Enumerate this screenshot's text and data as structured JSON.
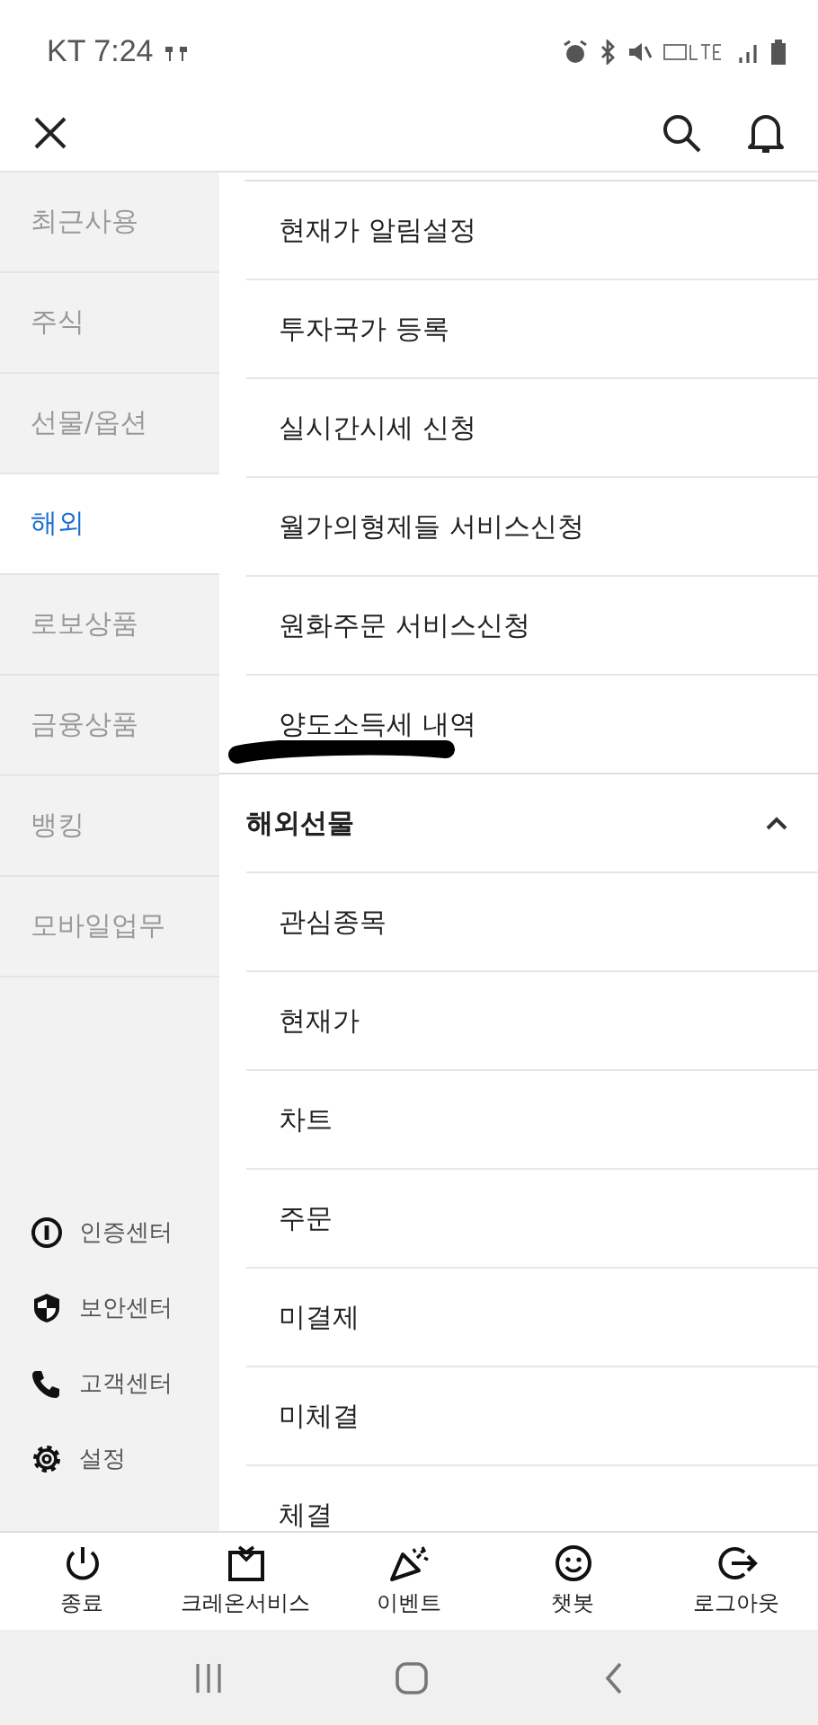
{
  "status_bar": {
    "carrier_time": "KT 7:24"
  },
  "sidebar": {
    "items": [
      {
        "label": "최근사용",
        "selected": false
      },
      {
        "label": "주식",
        "selected": false
      },
      {
        "label": "선물/옵션",
        "selected": false
      },
      {
        "label": "해외",
        "selected": true
      },
      {
        "label": "로보상품",
        "selected": false
      },
      {
        "label": "금융상품",
        "selected": false
      },
      {
        "label": "뱅킹",
        "selected": false
      },
      {
        "label": "모바일업무",
        "selected": false
      }
    ],
    "links": [
      {
        "kind": "cert",
        "label": "인증센터"
      },
      {
        "kind": "security",
        "label": "보안센터"
      },
      {
        "kind": "phone",
        "label": "고객센터"
      },
      {
        "kind": "settings",
        "label": "설정"
      }
    ]
  },
  "menu": {
    "items": [
      "현재가 알림설정",
      "투자국가 등록",
      "실시간시세 신청",
      "월가의형제들 서비스신청",
      "원화주문 서비스신청",
      "양도소득세 내역"
    ],
    "groups": [
      {
        "title": "해외선물",
        "expanded": true,
        "items": [
          "관심종목",
          "현재가",
          "차트",
          "주문",
          "미결제",
          "미체결",
          "체결"
        ]
      }
    ]
  },
  "bottom_nav": [
    {
      "kind": "power",
      "label": "종료"
    },
    {
      "kind": "gift",
      "label": "크레온서비스"
    },
    {
      "kind": "party",
      "label": "이벤트"
    },
    {
      "kind": "smile",
      "label": "챗봇"
    },
    {
      "kind": "logout",
      "label": "로그아웃"
    }
  ]
}
